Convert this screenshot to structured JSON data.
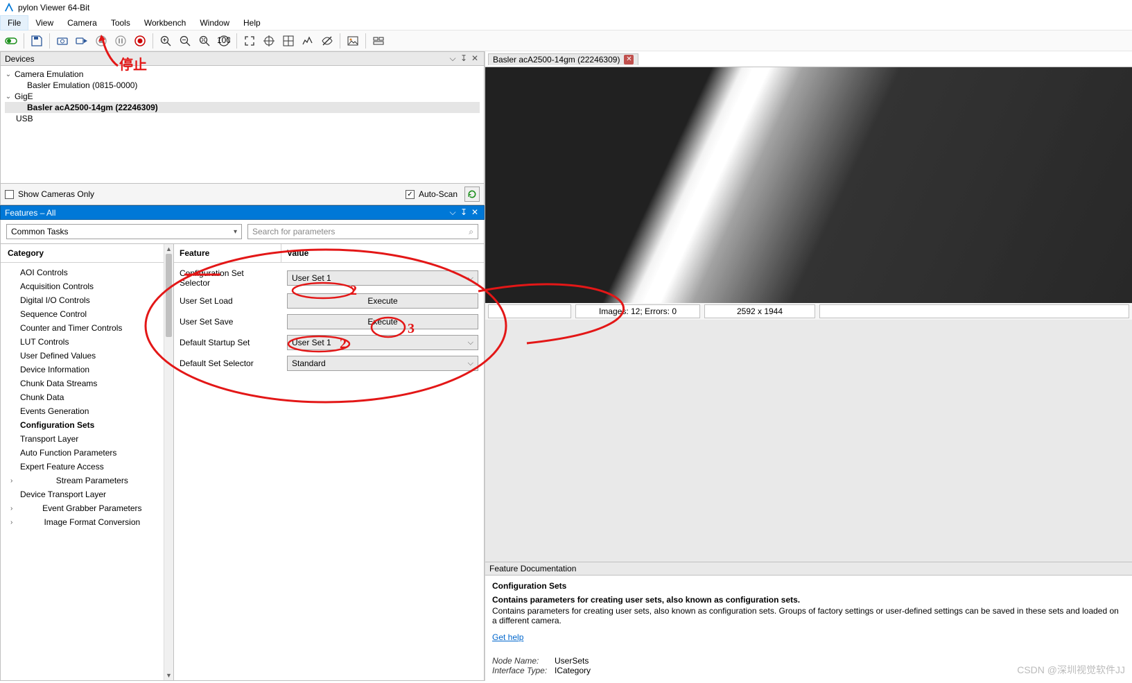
{
  "app": {
    "title": "pylon Viewer 64-Bit"
  },
  "menu": {
    "items": [
      "File",
      "View",
      "Camera",
      "Tools",
      "Workbench",
      "Window",
      "Help"
    ]
  },
  "toolbar": {
    "icons": [
      "toggle",
      "save",
      "camera-single",
      "camera-continuous",
      "stop",
      "pause",
      "record",
      "zoom-in",
      "zoom-out",
      "zoom-fit",
      "zoom-100",
      "fullscreen",
      "crosshair",
      "grid",
      "histogram",
      "visibility",
      "image",
      "panel"
    ]
  },
  "devices": {
    "header": "Devices",
    "show_only": "Show Cameras Only",
    "show_only_checked": false,
    "auto_scan": "Auto-Scan",
    "auto_scan_checked": true,
    "tree": {
      "cam_emu": "Camera Emulation",
      "basler_emu": "Basler Emulation (0815-0000)",
      "gige": "GigE",
      "camera": "Basler acA2500-14gm (22246309)",
      "usb": "USB"
    }
  },
  "features": {
    "header": "Features – All",
    "dropdown": "Common Tasks",
    "search_placeholder": "Search for parameters",
    "category_header": "Category",
    "categories": [
      "AOI Controls",
      "Acquisition Controls",
      "Digital I/O Controls",
      "Sequence Control",
      "Counter and Timer Controls",
      "LUT Controls",
      "User Defined Values",
      "Device Information",
      "Chunk Data Streams",
      "Chunk Data",
      "Events Generation",
      "Configuration Sets",
      "Transport Layer",
      "Auto Function Parameters",
      "Expert Feature Access",
      "Stream Parameters",
      "Device Transport Layer",
      "Event Grabber Parameters",
      "Image Format Conversion"
    ],
    "active_category": "Configuration Sets",
    "feature_col": "Feature",
    "value_col": "Value",
    "rows": [
      {
        "name": "Configuration Set Selector",
        "kind": "dropdown",
        "value": "User Set 1"
      },
      {
        "name": "User Set Load",
        "kind": "execute",
        "value": "Execute"
      },
      {
        "name": "User Set Save",
        "kind": "execute",
        "value": "Execute"
      },
      {
        "name": "Default Startup Set",
        "kind": "dropdown",
        "value": "User Set 1"
      },
      {
        "name": "Default Set Selector",
        "kind": "dropdown",
        "value": "Standard"
      }
    ]
  },
  "image": {
    "tab": "Basler acA2500-14gm (22246309)",
    "status_images": "Images: 12; Errors: 0",
    "status_res": "2592 x 1944"
  },
  "doc": {
    "header": "Feature Documentation",
    "title": "Configuration Sets",
    "bold": "Contains parameters for creating user sets, also known as configuration sets.",
    "desc": "Contains parameters for creating user sets, also known as configuration sets. Groups of factory settings or user-defined settings can be saved in these sets and loaded on a different camera.",
    "link": "Get help",
    "node_name_lab": "Node Name:",
    "node_name": "UserSets",
    "iface_lab": "Interface Type:",
    "iface": "ICategory"
  },
  "watermark": "CSDN @深圳视觉软件JJ",
  "annotations": {
    "stop": "停止",
    "two_a": "2",
    "two_b": "2",
    "three": "3"
  }
}
